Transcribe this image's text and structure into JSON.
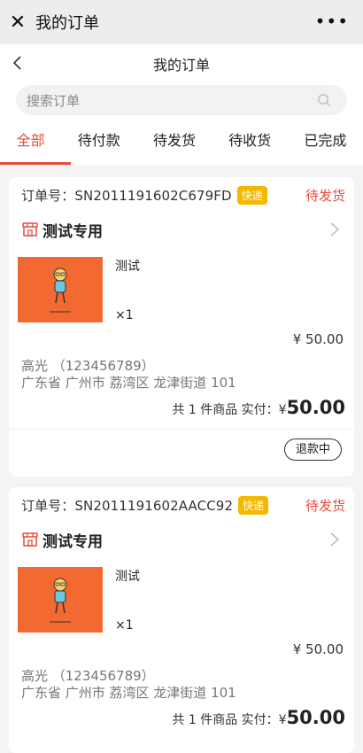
{
  "wechat_bar": {
    "close_glyph": "✕",
    "title": "我的订单",
    "more_glyph": "•••"
  },
  "nav": {
    "title": "我的订单"
  },
  "search": {
    "placeholder": "搜索订单"
  },
  "tabs": [
    {
      "label": "全部",
      "active": true
    },
    {
      "label": "待付款"
    },
    {
      "label": "待发货"
    },
    {
      "label": "待收货"
    },
    {
      "label": "已完成"
    }
  ],
  "colors": {
    "accent": "#e84b3c",
    "badge": "#f5b800",
    "thumb": "#f26a31"
  },
  "orders": [
    {
      "order_label": "订单号：",
      "order_no": "SN2011191602C679FD",
      "badge": "快递",
      "status": "待发货",
      "shop_name": "测试专用",
      "product_name": "测试",
      "qty": "×1",
      "price": "¥ 50.00",
      "contact": "高光 （123456789）",
      "address": "广东省 广州市 荔湾区 龙津街道 101",
      "summary": "共 1 件商品 实付：¥",
      "total": "50.00",
      "action": "退款中"
    },
    {
      "order_label": "订单号：",
      "order_no": "SN2011191602AACC92",
      "badge": "快递",
      "status": "待发货",
      "shop_name": "测试专用",
      "product_name": "测试",
      "qty": "×1",
      "price": "¥ 50.00",
      "contact": "高光 （123456789）",
      "address": "广东省 广州市 荔湾区 龙津街道 101",
      "summary": "共 1 件商品 实付：¥",
      "total": "50.00"
    }
  ]
}
